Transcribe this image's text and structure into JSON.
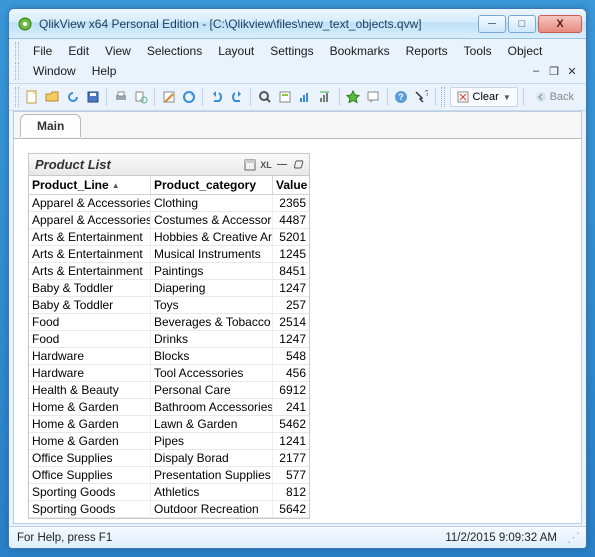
{
  "window": {
    "title": "QlikView x64 Personal Edition - [C:\\Qlikview\\files\\new_text_objects.qvw]"
  },
  "menu": {
    "items": [
      "File",
      "Edit",
      "View",
      "Selections",
      "Layout",
      "Settings",
      "Bookmarks",
      "Reports",
      "Tools",
      "Object",
      "Window",
      "Help"
    ]
  },
  "toolbar": {
    "clear_label": "Clear",
    "back_label": "Back"
  },
  "tabs": {
    "active": "Main"
  },
  "sheet_object": {
    "title": "Product List",
    "columns": [
      "Product_Line",
      "Product_category",
      "Value"
    ],
    "rows": [
      {
        "pl": "Apparel & Accessories",
        "pc": "Clothing",
        "val": 2365
      },
      {
        "pl": "Apparel & Accessories",
        "pc": "Costumes & Accessories",
        "val": 4487
      },
      {
        "pl": "Arts & Entertainment",
        "pc": "Hobbies & Creative Arts",
        "val": 5201
      },
      {
        "pl": "Arts & Entertainment",
        "pc": "Musical Instruments",
        "val": 1245
      },
      {
        "pl": "Arts & Entertainment",
        "pc": "Paintings",
        "val": 8451
      },
      {
        "pl": "Baby & Toddler",
        "pc": "Diapering",
        "val": 1247
      },
      {
        "pl": "Baby & Toddler",
        "pc": "Toys",
        "val": 257
      },
      {
        "pl": "Food",
        "pc": "Beverages & Tobacco",
        "val": 2514
      },
      {
        "pl": "Food",
        "pc": "Drinks",
        "val": 1247
      },
      {
        "pl": "Hardware",
        "pc": "Blocks",
        "val": 548
      },
      {
        "pl": "Hardware",
        "pc": "Tool Accessories",
        "val": 456
      },
      {
        "pl": "Health & Beauty",
        "pc": "Personal Care",
        "val": 6912
      },
      {
        "pl": "Home & Garden",
        "pc": "Bathroom Accessories",
        "val": 241
      },
      {
        "pl": "Home & Garden",
        "pc": "Lawn & Garden",
        "val": 5462
      },
      {
        "pl": "Home & Garden",
        "pc": "Pipes",
        "val": 1241
      },
      {
        "pl": "Office Supplies",
        "pc": "Dispaly Borad",
        "val": 2177
      },
      {
        "pl": "Office Supplies",
        "pc": "Presentation Supplies",
        "val": 577
      },
      {
        "pl": "Sporting Goods",
        "pc": "Athletics",
        "val": 812
      },
      {
        "pl": "Sporting Goods",
        "pc": "Outdoor Recreation",
        "val": 5642
      }
    ]
  },
  "statusbar": {
    "hint": "For Help, press F1",
    "datetime": "11/2/2015 9:09:32 AM"
  }
}
